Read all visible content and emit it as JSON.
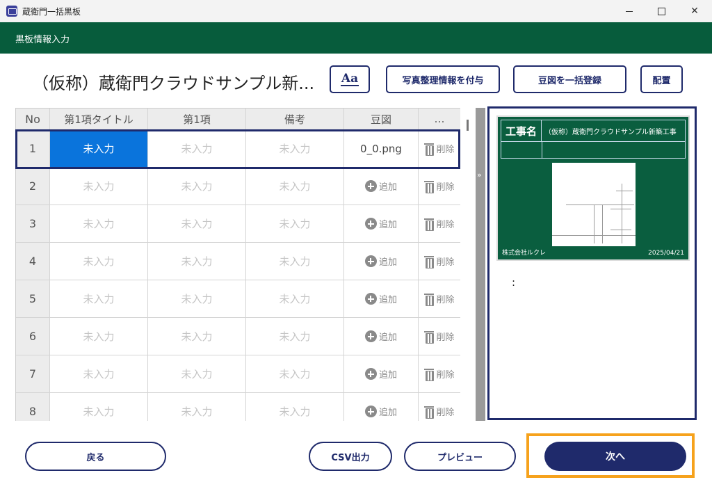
{
  "window": {
    "title": "蔵衛門一括黒板",
    "close_symbol": "✕"
  },
  "header": {
    "section_title": "黒板情報入力"
  },
  "project": {
    "title": "（仮称）蔵衛門クラウドサンプル新..."
  },
  "toolbar": {
    "font_button": "Aa",
    "photo_info_button": "写真整理情報を付与",
    "mame_bulk_button": "豆図を一括登録",
    "place_button": "配置"
  },
  "table": {
    "columns": [
      "No",
      "第1項タイトル",
      "第1項",
      "備考",
      "豆図",
      "…"
    ],
    "rows": [
      {
        "no": "1",
        "title1": "未入力",
        "item1": "未入力",
        "remarks": "未入力",
        "mame": "0_0.png",
        "action": "削除"
      },
      {
        "no": "2",
        "title1": "未入力",
        "item1": "未入力",
        "remarks": "未入力",
        "mame": "追加",
        "action": "削除"
      },
      {
        "no": "3",
        "title1": "未入力",
        "item1": "未入力",
        "remarks": "未入力",
        "mame": "追加",
        "action": "削除"
      },
      {
        "no": "4",
        "title1": "未入力",
        "item1": "未入力",
        "remarks": "未入力",
        "mame": "追加",
        "action": "削除"
      },
      {
        "no": "5",
        "title1": "未入力",
        "item1": "未入力",
        "remarks": "未入力",
        "mame": "追加",
        "action": "削除"
      },
      {
        "no": "6",
        "title1": "未入力",
        "item1": "未入力",
        "remarks": "未入力",
        "mame": "追加",
        "action": "削除"
      },
      {
        "no": "7",
        "title1": "未入力",
        "item1": "未入力",
        "remarks": "未入力",
        "mame": "追加",
        "action": "削除"
      },
      {
        "no": "8",
        "title1": "未入力",
        "item1": "未入力",
        "remarks": "未入力",
        "mame": "追加",
        "action": "削除"
      }
    ]
  },
  "splitter": {
    "symbol": "»"
  },
  "preview": {
    "board_label": "工事名",
    "board_value": "（仮称）蔵衛門クラウドサンプル新築工事",
    "company": "株式会社ルクレ",
    "date": "2025/04/21",
    "caption": ":"
  },
  "footer": {
    "back_button": "戻る",
    "csv_button": "CSV出力",
    "preview_button": "プレビュー",
    "next_button": "次へ"
  },
  "colors": {
    "header_green": "#075c3c",
    "accent_navy": "#1f2a6b",
    "selection_blue": "#0a74dc",
    "highlight_orange": "#f6a21c"
  }
}
